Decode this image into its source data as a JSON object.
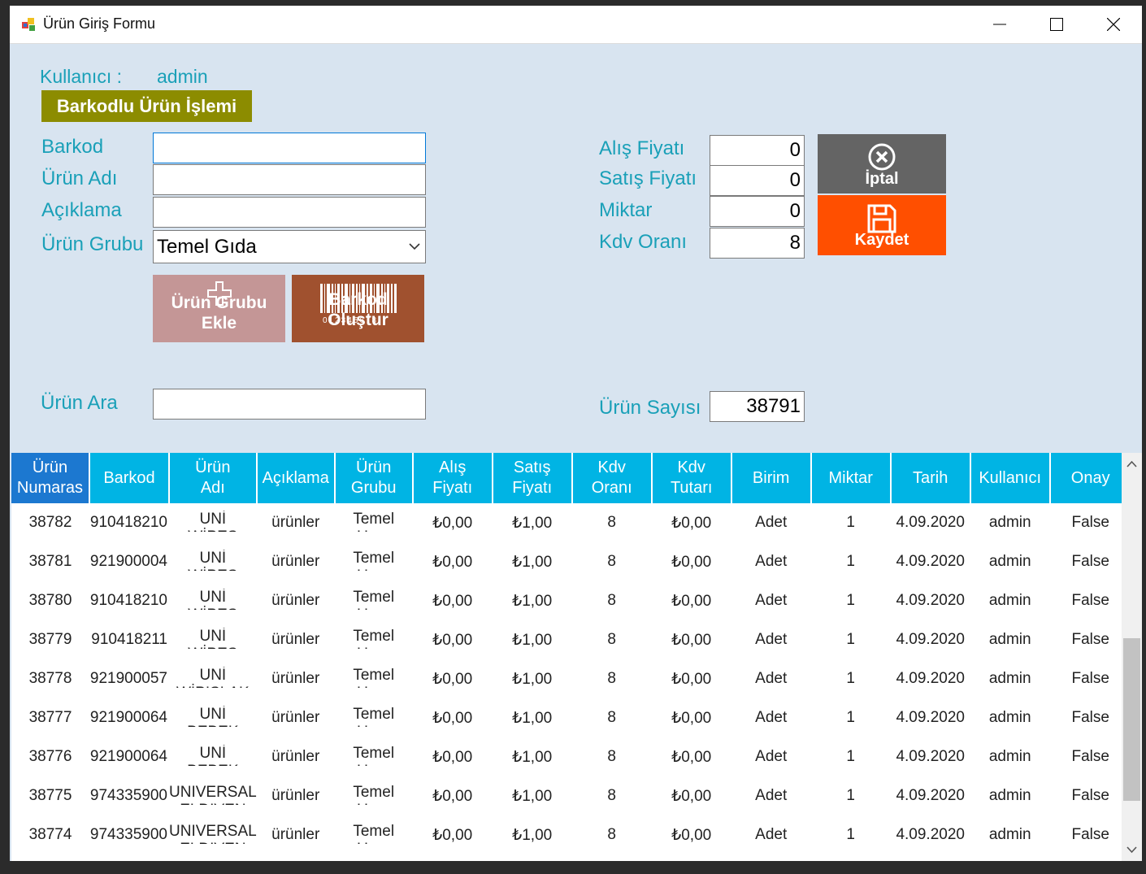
{
  "window": {
    "title": "Ürün Giriş Formu"
  },
  "user": {
    "label": "Kullanıcı :",
    "value": "admin"
  },
  "banner": "Barkodlu Ürün İşlemi",
  "left_form": {
    "barcode_label": "Barkod",
    "name_label": "Ürün Adı",
    "desc_label": "Açıklama",
    "group_label": "Ürün Grubu",
    "group_value": "Temel Gıda",
    "barcode_value": "",
    "name_value": "",
    "desc_value": ""
  },
  "buttons": {
    "add_group_line1": "Ürün Grubu",
    "add_group_line2": "Ekle",
    "barcode_create_top": "Barkod",
    "barcode_create_bottom": "Oluştur",
    "barcode_digits": "012345678",
    "cancel": "İptal",
    "save": "Kaydet"
  },
  "right_form": {
    "buy_label": "Alış Fiyatı",
    "sell_label": "Satış Fiyatı",
    "qty_label": "Miktar",
    "vat_label": "Kdv Oranı",
    "buy_value": "0",
    "sell_value": "0",
    "qty_value": "0",
    "vat_value": "8"
  },
  "search": {
    "label": "Ürün Ara",
    "value": ""
  },
  "count": {
    "label": "Ürün Sayısı",
    "value": "38791"
  },
  "colors": {
    "accent": "#00b4e4",
    "label": "#1aa0b8",
    "cancel": "#646464",
    "save": "#ff4f00",
    "add_group": "#c49696",
    "barcode": "#a0512f",
    "banner": "#8c8c00"
  },
  "grid": {
    "headers": [
      [
        "Ürün",
        "Numaras"
      ],
      [
        "Barkod"
      ],
      [
        "Ürün",
        "Adı"
      ],
      [
        "Açıklama"
      ],
      [
        "Ürün",
        "Grubu"
      ],
      [
        "Alış",
        "Fiyatı"
      ],
      [
        "Satış",
        "Fiyatı"
      ],
      [
        "Kdv",
        "Oranı"
      ],
      [
        "Kdv",
        "Tutarı"
      ],
      [
        "Birim"
      ],
      [
        "Miktar"
      ],
      [
        "Tarih"
      ],
      [
        "Kullanıcı"
      ],
      [
        "Onay"
      ]
    ],
    "rows": [
      [
        "38782",
        "910418210",
        [
          "UNİ",
          "WİPES"
        ],
        "ürünler",
        [
          "Temel",
          "Urun"
        ],
        "₺0,00",
        "₺1,00",
        "8",
        "₺0,00",
        "Adet",
        "1",
        "4.09.2020",
        "admin",
        "False"
      ],
      [
        "38781",
        "921900004",
        [
          "UNİ",
          "WİPES"
        ],
        "ürünler",
        [
          "Temel",
          "Urun"
        ],
        "₺0,00",
        "₺1,00",
        "8",
        "₺0,00",
        "Adet",
        "1",
        "4.09.2020",
        "admin",
        "False"
      ],
      [
        "38780",
        "910418210",
        [
          "UNİ",
          "WİPES"
        ],
        "ürünler",
        [
          "Temel",
          "Urun"
        ],
        "₺0,00",
        "₺1,00",
        "8",
        "₺0,00",
        "Adet",
        "1",
        "4.09.2020",
        "admin",
        "False"
      ],
      [
        "38779",
        "910418211",
        [
          "UNİ",
          "WİPES"
        ],
        "ürünler",
        [
          "Temel",
          "Urun"
        ],
        "₺0,00",
        "₺1,00",
        "8",
        "₺0,00",
        "Adet",
        "1",
        "4.09.2020",
        "admin",
        "False"
      ],
      [
        "38778",
        "921900057",
        [
          "UNİ",
          "WİPISLAK"
        ],
        "ürünler",
        [
          "Temel",
          "Urun"
        ],
        "₺0,00",
        "₺1,00",
        "8",
        "₺0,00",
        "Adet",
        "1",
        "4.09.2020",
        "admin",
        "False"
      ],
      [
        "38777",
        "921900064",
        [
          "UNİ",
          "BEBEK"
        ],
        "ürünler",
        [
          "Temel",
          "Urun"
        ],
        "₺0,00",
        "₺1,00",
        "8",
        "₺0,00",
        "Adet",
        "1",
        "4.09.2020",
        "admin",
        "False"
      ],
      [
        "38776",
        "921900064",
        [
          "UNİ",
          "BEBEK"
        ],
        "ürünler",
        [
          "Temel",
          "Urun"
        ],
        "₺0,00",
        "₺1,00",
        "8",
        "₺0,00",
        "Adet",
        "1",
        "4.09.2020",
        "admin",
        "False"
      ],
      [
        "38775",
        "974335900",
        [
          "UNIVERSAL",
          "ELDIVEN"
        ],
        "ürünler",
        [
          "Temel",
          "Urun"
        ],
        "₺0,00",
        "₺1,00",
        "8",
        "₺0,00",
        "Adet",
        "1",
        "4.09.2020",
        "admin",
        "False"
      ],
      [
        "38774",
        "974335900",
        [
          "UNIVERSAL",
          "ELDIVEN"
        ],
        "ürünler",
        [
          "Temel",
          "Urun"
        ],
        "₺0,00",
        "₺1,00",
        "8",
        "₺0,00",
        "Adet",
        "1",
        "4.09.2020",
        "admin",
        "False"
      ]
    ]
  }
}
